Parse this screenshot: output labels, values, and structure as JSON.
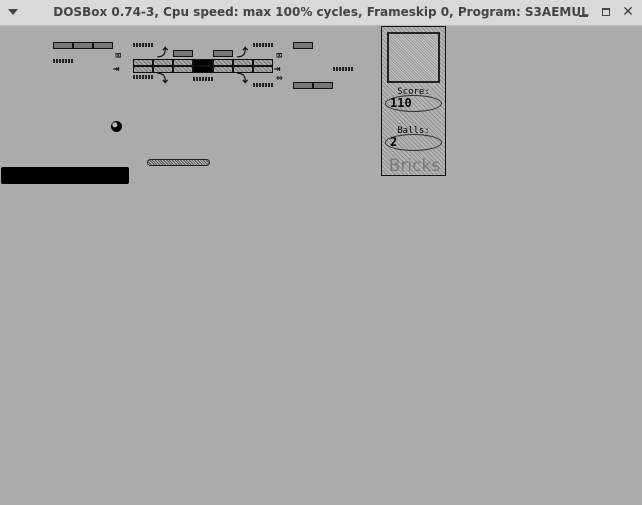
{
  "window": {
    "title": "DOSBox 0.74-3, Cpu speed: max 100% cycles, Frameskip  0, Program:  S3AEMUL",
    "menu_icon": "chevron-down-icon",
    "minimize_icon": "minimize-icon",
    "maximize_icon": "maximize-icon",
    "close_icon": "close-icon"
  },
  "game": {
    "name": "Bricks",
    "score_label": "Score:",
    "score_value": "110",
    "balls_label": "Balls:",
    "balls_value": "2"
  }
}
